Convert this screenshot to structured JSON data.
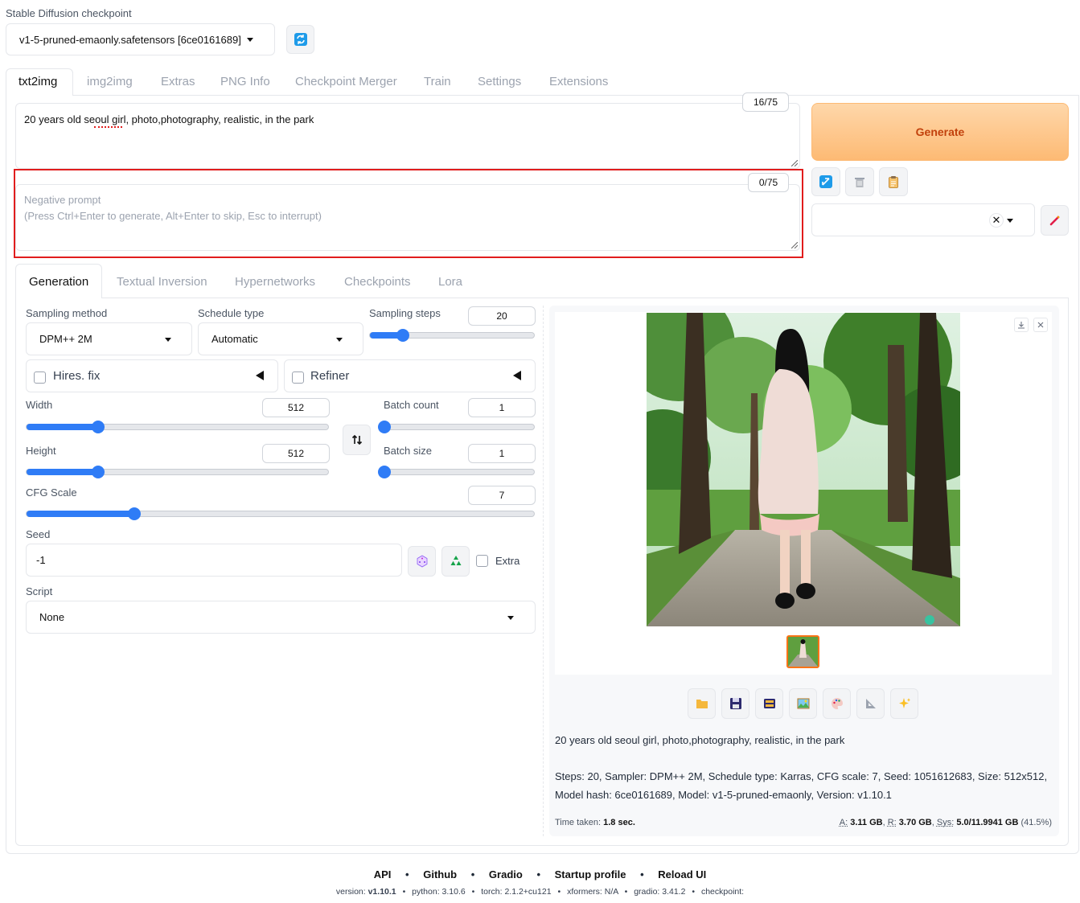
{
  "header": {
    "checkpoint_label": "Stable Diffusion checkpoint",
    "checkpoint_value": "v1-5-pruned-emaonly.safetensors [6ce0161689]"
  },
  "main_tabs": [
    "txt2img",
    "img2img",
    "Extras",
    "PNG Info",
    "Checkpoint Merger",
    "Train",
    "Settings",
    "Extensions"
  ],
  "prompt": {
    "text": "20 years old seoul girl, photo,photography, realistic, in the park",
    "token_count": "16/75"
  },
  "negative_prompt": {
    "placeholder_line1": "Negative prompt",
    "placeholder_line2": "(Press Ctrl+Enter to generate, Alt+Enter to skip, Esc to interrupt)",
    "token_count": "0/75"
  },
  "generate_label": "Generate",
  "sub_tabs": [
    "Generation",
    "Textual Inversion",
    "Hypernetworks",
    "Checkpoints",
    "Lora"
  ],
  "settings": {
    "sampling_method_label": "Sampling method",
    "sampling_method_value": "DPM++ 2M",
    "schedule_type_label": "Schedule type",
    "schedule_type_value": "Automatic",
    "sampling_steps_label": "Sampling steps",
    "sampling_steps_value": "20",
    "hires_label": "Hires. fix",
    "refiner_label": "Refiner",
    "width_label": "Width",
    "width_value": "512",
    "height_label": "Height",
    "height_value": "512",
    "batch_count_label": "Batch count",
    "batch_count_value": "1",
    "batch_size_label": "Batch size",
    "batch_size_value": "1",
    "cfg_label": "CFG Scale",
    "cfg_value": "7",
    "seed_label": "Seed",
    "seed_value": "-1",
    "extra_label": "Extra",
    "script_label": "Script",
    "script_value": "None"
  },
  "sliders": {
    "sampling_steps_fraction": 0.2,
    "width_fraction": 0.237,
    "height_fraction": 0.237,
    "batch_count_fraction": 0.0,
    "batch_size_fraction": 0.0,
    "cfg_fraction": 0.213
  },
  "output": {
    "prompt_text": "20 years old seoul girl, photo,photography, realistic, in the park",
    "params_line1": "Steps: 20, Sampler: DPM++ 2M, Schedule type: Karras, CFG scale: 7, Seed: 1051612683, Size: 512x512,",
    "params_line2": "Model hash: 6ce0161689, Model: v1-5-pruned-emaonly, Version: v1.10.1",
    "time_label": "Time taken:",
    "time_value": "1.8 sec.",
    "mem_a_label": "A:",
    "mem_a_value": "3.11 GB",
    "mem_r_label": "R:",
    "mem_r_value": "3.70 GB",
    "mem_sys_label": "Sys:",
    "mem_sys_value": "5.0/11.9941 GB",
    "mem_pct": "(41.5%)"
  },
  "footer": {
    "links": [
      "API",
      "Github",
      "Gradio",
      "Startup profile",
      "Reload UI"
    ],
    "version_label": "version:",
    "version_value": "v1.10.1",
    "python": "python: 3.10.6",
    "torch": "torch: 2.1.2+cu121",
    "xformers": "xformers: N/A",
    "gradio": "gradio: 3.41.2",
    "checkpoint": "checkpoint:"
  },
  "icons": {
    "refresh": "refresh-icon",
    "swap": "swap-icon",
    "dice": "dice-icon",
    "recycle": "recycle-icon",
    "folder": "folder-icon",
    "save": "save-icon",
    "zip": "zip-icon",
    "image": "image-icon",
    "palette": "palette-icon",
    "ruler": "ruler-icon",
    "sparkle": "sparkle-icon"
  },
  "colors": {
    "accent": "#2f7cf6",
    "generate_text": "#c2410c",
    "highlight": "#e11d1d"
  }
}
